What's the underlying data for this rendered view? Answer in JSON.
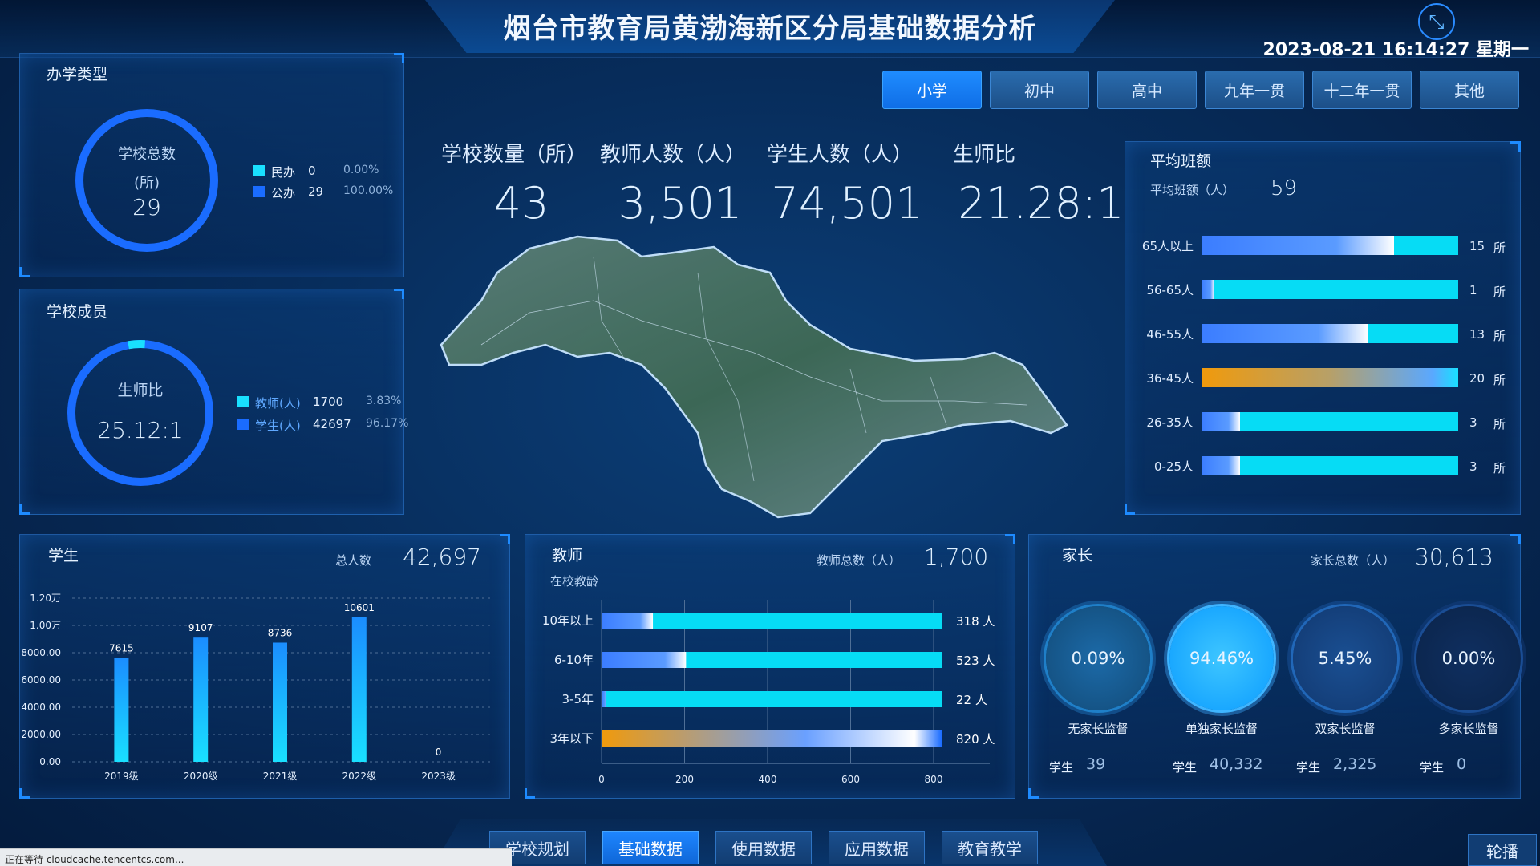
{
  "header": {
    "title": "烟台市教育局黄渤海新区分局基础数据分析",
    "datetime": "2023-08-21 16:14:27 星期一",
    "tabs": [
      {
        "label": "小学",
        "active": true
      },
      {
        "label": "初中",
        "active": false
      },
      {
        "label": "高中",
        "active": false
      },
      {
        "label": "九年一贯",
        "active": false
      },
      {
        "label": "十二年一贯",
        "active": false
      },
      {
        "label": "其他",
        "active": false
      }
    ]
  },
  "stats": [
    {
      "label": "学校数量（所）",
      "value": "43"
    },
    {
      "label": "教师人数（人）",
      "value": "3,501"
    },
    {
      "label": "学生人数（人）",
      "value": "74,501"
    },
    {
      "label": "生师比",
      "value": "21.28:1"
    }
  ],
  "school_type": {
    "title": "办学类型",
    "center_line1": "学校总数",
    "center_line2": "(所)",
    "center_value": "29",
    "legend": [
      {
        "label": "民办",
        "count": "0",
        "pct": "0.00%",
        "color": "#19e0ff"
      },
      {
        "label": "公办",
        "count": "29",
        "pct": "100.00%",
        "color": "#1a6cff"
      }
    ]
  },
  "members": {
    "title": "学校成员",
    "center_label": "生师比",
    "center_value": "25.12:1",
    "teacher_fraction": 0.0383,
    "legend": [
      {
        "label": "教师(人)",
        "count": "1700",
        "pct": "3.83%",
        "color": "#19e0ff"
      },
      {
        "label": "学生(人)",
        "count": "42697",
        "pct": "96.17%",
        "color": "#1a6cff"
      }
    ]
  },
  "avg_class": {
    "title": "平均班额",
    "sub_label": "平均班额（人）",
    "sub_value": "59",
    "unit": "所",
    "rows": [
      {
        "label": "65人以上",
        "count": "15",
        "fraction": 0.75
      },
      {
        "label": "56-65人",
        "count": "1",
        "fraction": 0.05
      },
      {
        "label": "46-55人",
        "count": "13",
        "fraction": 0.65
      },
      {
        "label": "36-45人",
        "count": "20",
        "fraction": 1.0,
        "highlight": true
      },
      {
        "label": "26-35人",
        "count": "3",
        "fraction": 0.15
      },
      {
        "label": "0-25人",
        "count": "3",
        "fraction": 0.15
      }
    ]
  },
  "students": {
    "title": "学生",
    "total_label": "总人数",
    "total_value": "42,697"
  },
  "teachers": {
    "title": "教师",
    "sub_title": "在校教龄",
    "total_label": "教师总数（人）",
    "total_value": "1,700",
    "unit": "人"
  },
  "parents": {
    "title": "家长",
    "total_label": "家长总数（人）",
    "total_value": "30,613",
    "student_label": "学生",
    "items": [
      {
        "pct": "0.09%",
        "label": "无家长监督",
        "students": "39",
        "style": "mid"
      },
      {
        "pct": "94.46%",
        "label": "单独家长监督",
        "students": "40,332",
        "style": "bright"
      },
      {
        "pct": "5.45%",
        "label": "双家长监督",
        "students": "2,325",
        "style": "dark"
      },
      {
        "pct": "0.00%",
        "label": "多家长监督",
        "students": "0",
        "style": "darker"
      }
    ]
  },
  "bottom_nav": {
    "items": [
      {
        "label": "学校规划",
        "active": false
      },
      {
        "label": "基础数据",
        "active": true
      },
      {
        "label": "使用数据",
        "active": false
      },
      {
        "label": "应用数据",
        "active": false
      },
      {
        "label": "教育教学",
        "active": false
      }
    ],
    "carousel_label": "轮播"
  },
  "status_bar": {
    "text": "正在等待 cloudcache.tencentcs.com..."
  },
  "chart_data": [
    {
      "type": "bar",
      "categories": [
        "2019级",
        "2020级",
        "2021级",
        "2022级",
        "2023级"
      ],
      "values": [
        7615,
        9107,
        8736,
        10601,
        0
      ],
      "title": "",
      "xlabel": "",
      "ylabel": "",
      "ylim": [
        0,
        12000
      ],
      "yticks": [
        "0.00",
        "2000.00",
        "4000.00",
        "6000.00",
        "8000.00",
        "1.00万",
        "1.20万"
      ],
      "grid": true
    },
    {
      "type": "bar",
      "orientation": "horizontal",
      "categories": [
        "10年以上",
        "6-10年",
        "3-5年",
        "3年以下"
      ],
      "values": [
        318,
        523,
        22,
        820
      ],
      "xlim": [
        0,
        800
      ],
      "xticks": [
        "0",
        "200",
        "400",
        "600",
        "800"
      ],
      "title": "",
      "xlabel": "",
      "ylabel": ""
    }
  ]
}
